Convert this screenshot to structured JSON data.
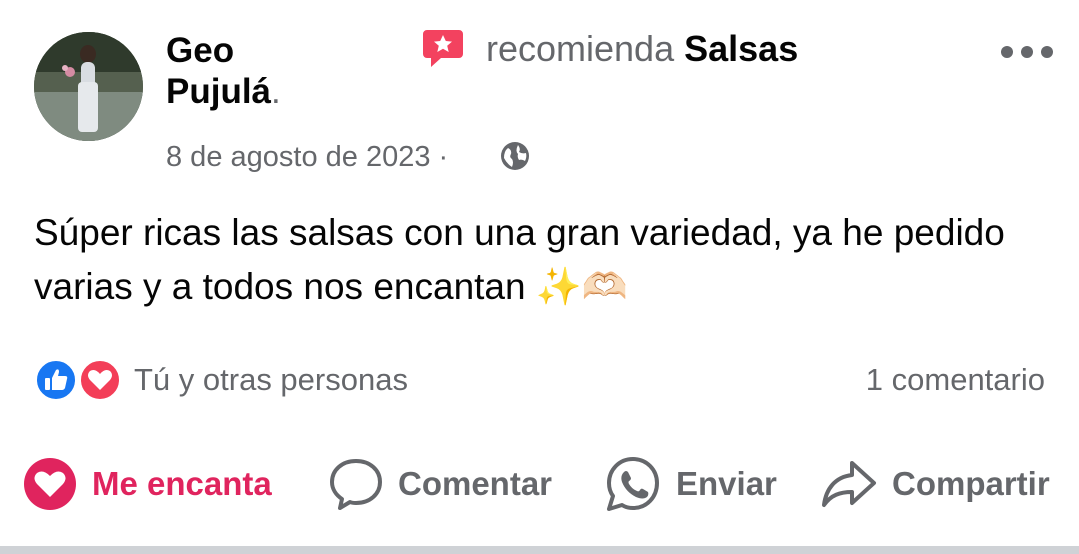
{
  "post": {
    "author_first": "Geo",
    "author_last": "Pujulá",
    "author_last_suffix": ".",
    "action_text": "recomienda",
    "page_name": "Salsas",
    "date": "8 de agosto de 2023",
    "separator": "·",
    "privacy_icon": "globe-icon",
    "body": "Súper ricas las salsas con una gran variedad, ya he pedido varias y a todos nos encantan ✨🫶🏻"
  },
  "reactions": {
    "icons": [
      "like-icon",
      "love-icon"
    ],
    "summary": "Tú y otras personas",
    "comments": "1 comentario"
  },
  "actions": {
    "love": "Me encanta",
    "comment": "Comentar",
    "send": "Enviar",
    "share": "Compartir"
  },
  "colors": {
    "accent_love": "#e0245e",
    "secondary_text": "#65676b",
    "like_blue": "#1877f2",
    "recommend_pink": "#f3425f"
  }
}
